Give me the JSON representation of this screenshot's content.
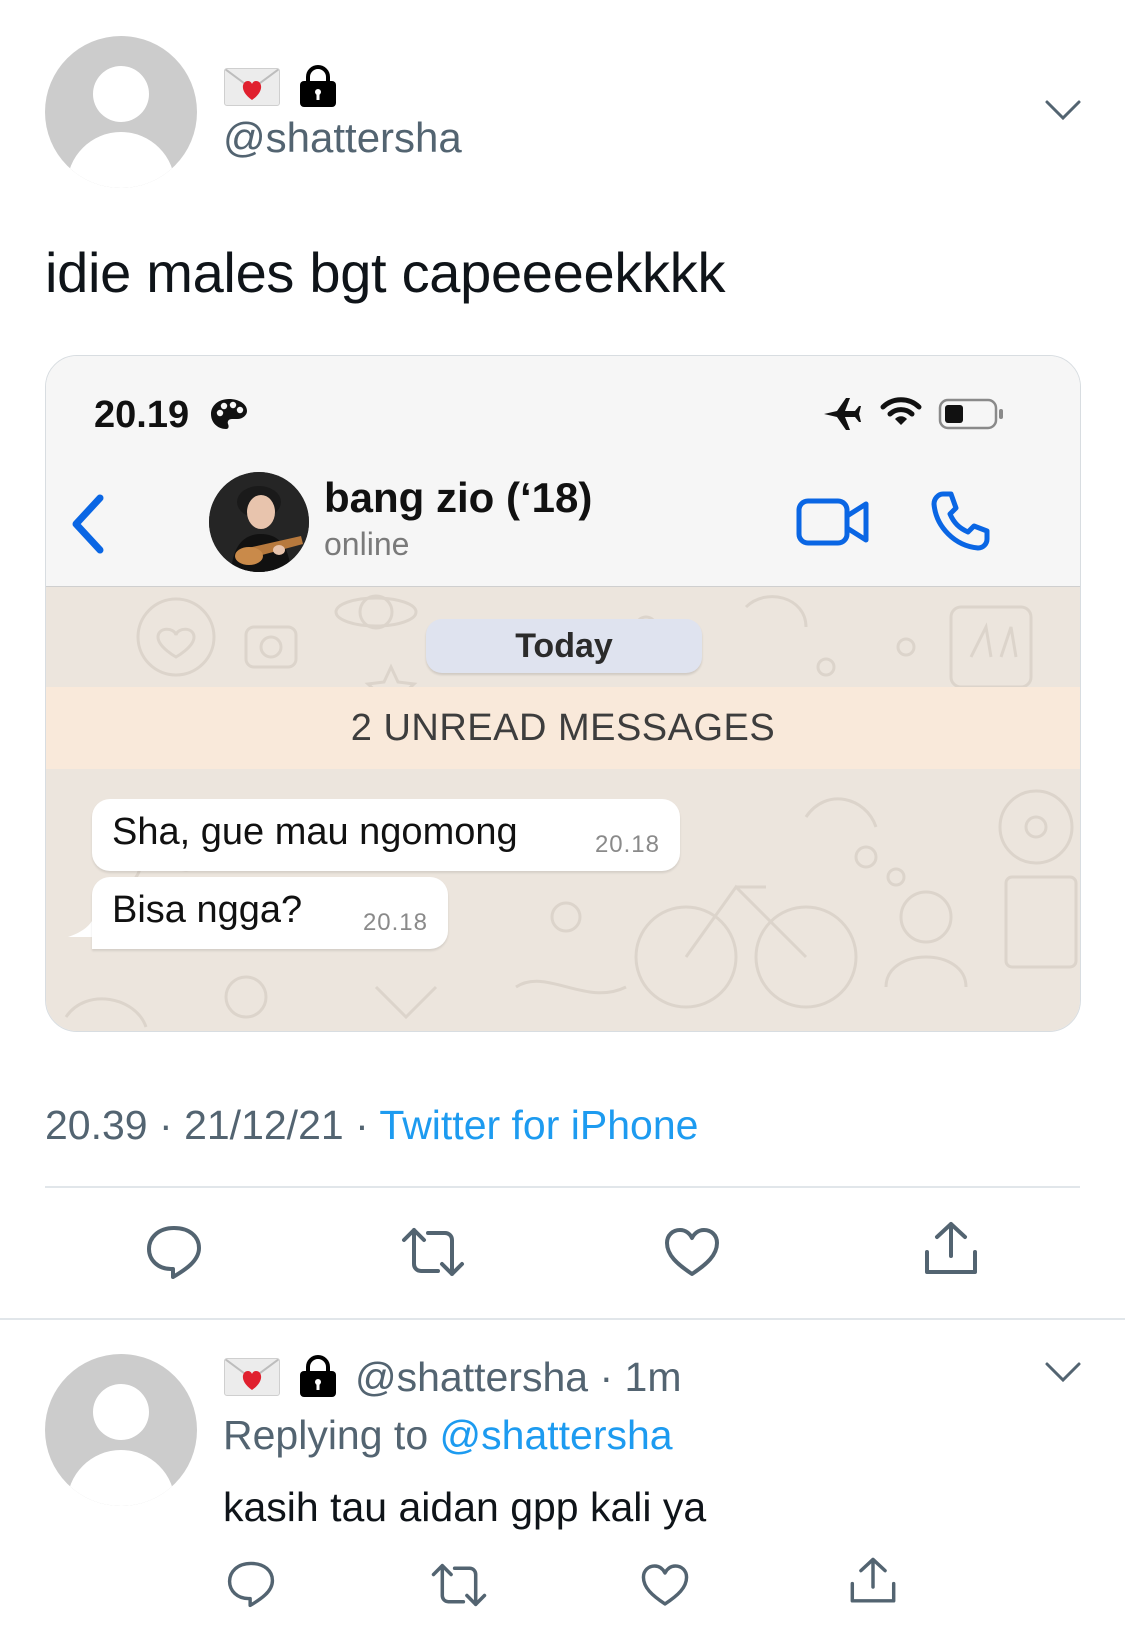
{
  "tweet": {
    "handle": "@shattersha",
    "text": "idie males bgt capeeeekkkk",
    "time": "20.39",
    "date": "21/12/21",
    "source": "Twitter for iPhone",
    "separator": "·"
  },
  "screenshot": {
    "status_time": "20.19",
    "contact_name": "bang zio (‘18)",
    "contact_status": "online",
    "date_label": "Today",
    "unread_label": "2 UNREAD MESSAGES",
    "messages": [
      {
        "text": "Sha, gue mau ngomong",
        "time": "20.18"
      },
      {
        "text": "Bisa ngga?",
        "time": "20.18"
      }
    ]
  },
  "reply": {
    "handle": "@shattersha",
    "age": "1m",
    "separator": "·",
    "replying_prefix": "Replying to",
    "replying_to": "@shattersha",
    "text": "kasih tau aidan gpp kali ya"
  },
  "colors": {
    "accent": "#1d9bf0",
    "secondary_text": "#536471",
    "whatsapp_blue": "#0a66e4",
    "unread_bg": "#f9e9da"
  },
  "icons": [
    "envelope-heart-icon",
    "lock-icon",
    "chevron-down-icon",
    "back-arrow-icon",
    "video-call-icon",
    "phone-call-icon",
    "airplane-icon",
    "wifi-icon",
    "battery-icon",
    "reply-icon",
    "retweet-icon",
    "like-icon",
    "share-icon"
  ]
}
